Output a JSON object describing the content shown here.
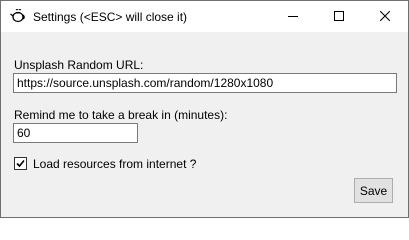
{
  "window": {
    "title": "Settings (<ESC> will close it)",
    "icon": "teapot-icon",
    "controls": [
      "minimize-icon",
      "maximize-icon",
      "close-icon"
    ]
  },
  "form": {
    "url_label": "Unsplash Random URL:",
    "url_value": "https://source.unsplash.com/random/1280x1080",
    "break_label": "Remind me to take a break in (minutes):",
    "break_value": "60",
    "internet_label": "Load resources from internet ?",
    "internet_checked": true,
    "save_label": "Save"
  }
}
